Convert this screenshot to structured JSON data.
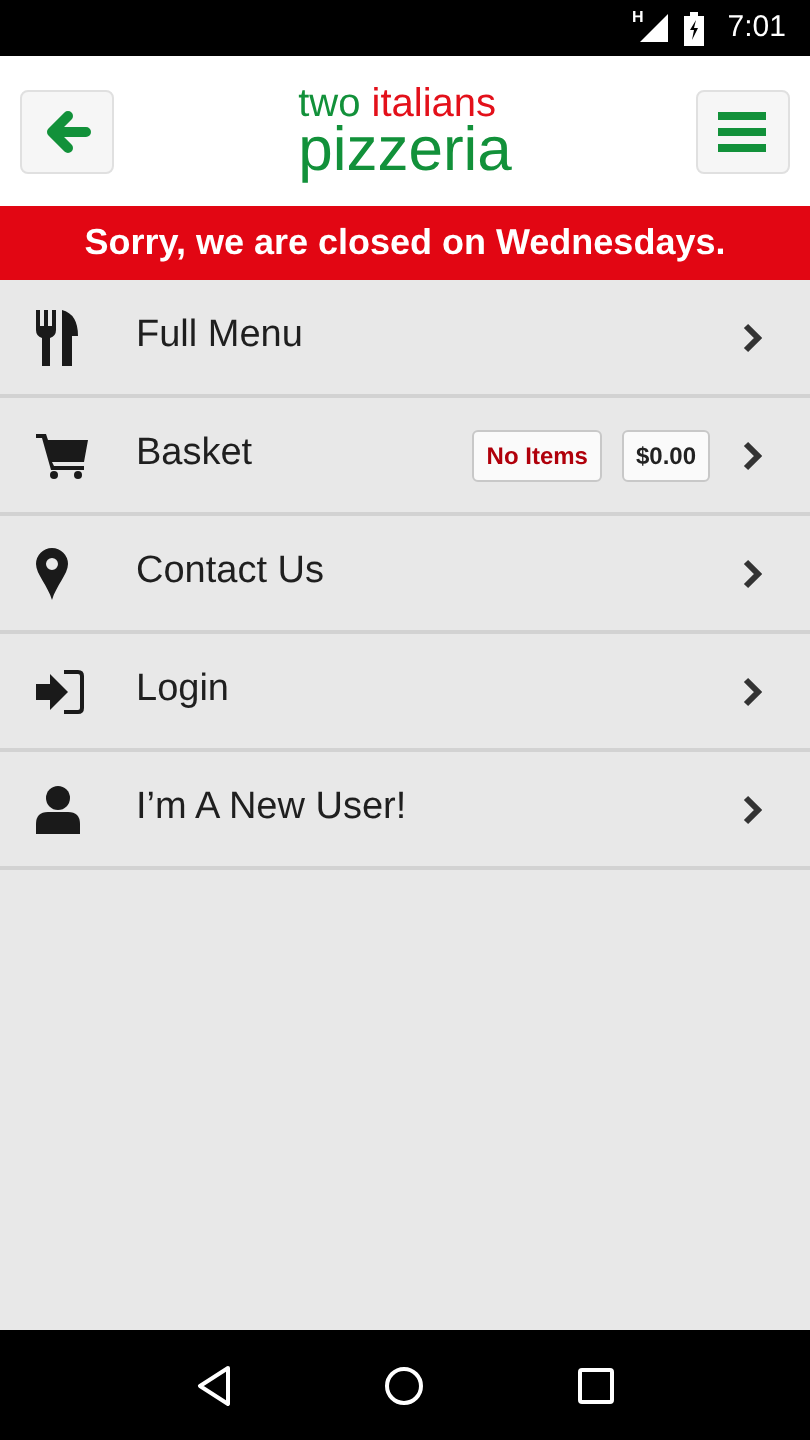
{
  "status_bar": {
    "network": "H",
    "time": "7:01"
  },
  "header": {
    "logo": {
      "line_1a": "two",
      "line_1b": "italians",
      "line_2": "pizzeria"
    }
  },
  "notice": "Sorry, we are closed on Wednesdays.",
  "menu_items": [
    {
      "label": "Full Menu"
    },
    {
      "label": "Basket",
      "badges": [
        {
          "text": "No Items",
          "kind": "alert"
        },
        {
          "text": "$0.00",
          "kind": "plain"
        }
      ]
    },
    {
      "label": "Contact Us"
    },
    {
      "label": "Login"
    },
    {
      "label": "I’m A New User!"
    }
  ]
}
